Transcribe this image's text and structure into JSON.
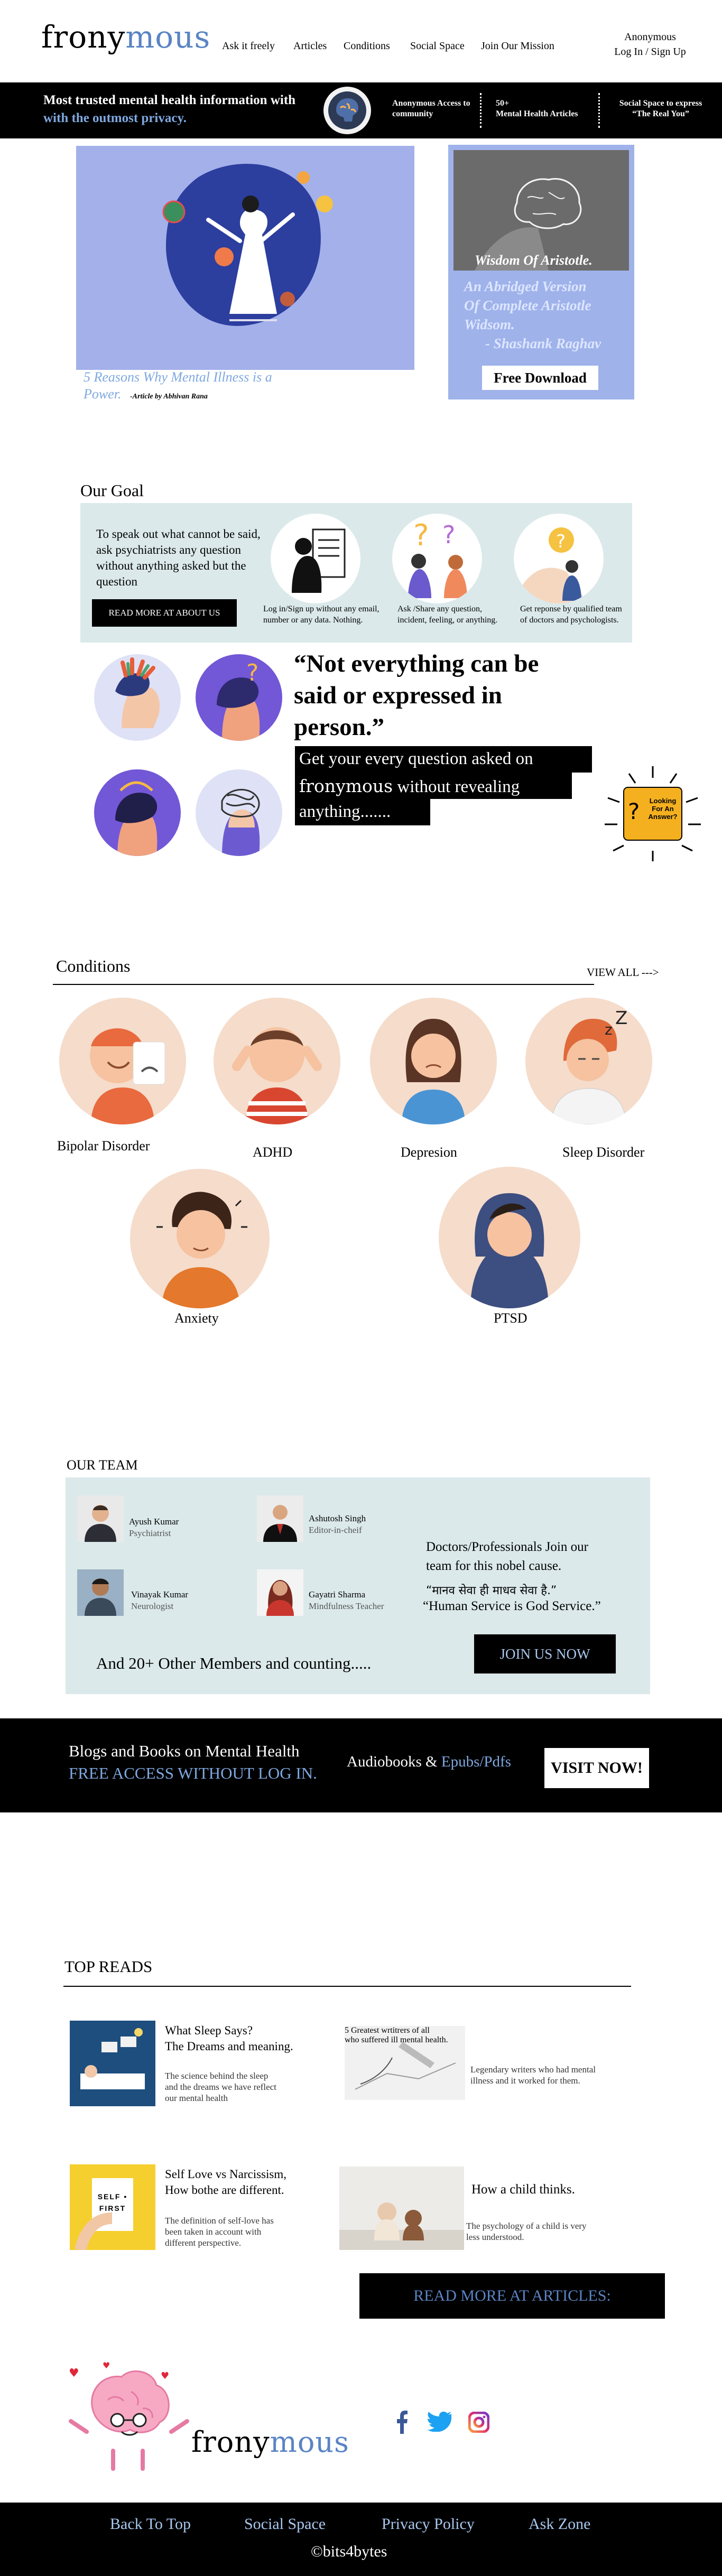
{
  "header": {
    "logo_part1": "frony",
    "logo_part2": "mous",
    "nav": [
      "Ask it freely",
      "Articles",
      "Conditions",
      "Social Space",
      "Join Our Mission"
    ],
    "account_line1": "Anonymous",
    "account_line2": "Log In / Sign Up"
  },
  "banner": {
    "headline": "Most trusted mental health information with",
    "subline": "with the outmost privacy.",
    "feature1": "Anonymous Access to community",
    "feature2_line1": "50+",
    "feature2_line2": "Mental Health Articles",
    "feature3_line1": "Social Space to express",
    "feature3_line2": "“The Real You”"
  },
  "hero": {
    "article_title_line1": "5 Reasons Why Mental Illness is a",
    "article_title_line2": "Power.",
    "article_author": "-Article by Abhivan Rana",
    "book_caption": "Wisdom Of Aristotle.",
    "book_text_line1": "An Abridged Version",
    "book_text_line2": "Of Complete Aristotle",
    "book_text_line3": "Widsom.",
    "book_author": "- Shashank Raghav",
    "download_label": "Free Download"
  },
  "goal": {
    "heading": "Our Goal",
    "statement": "To speak out what cannot be said, ask psychiatrists any question without anything asked but the question",
    "about_button": "READ MORE AT ABOUT US",
    "step1": "Log in/Sign up without any email, number or any data. Nothing.",
    "step2": "Ask /Share any question, incident, feeling, or anything.",
    "step3": "Get reponse by qualified team of doctors and psychologists."
  },
  "quote": {
    "text_line1": "“Not everything can be",
    "text_line2": "said or expressed in",
    "text_line3": "person.”",
    "cta_line1": "Get your every question asked on",
    "cta_brand": "frony",
    "cta_brand2": "mous",
    "cta_line2": " without revealing",
    "cta_line3": "anything.......",
    "badge": "Looking For An Answer?"
  },
  "conditions": {
    "heading": "Conditions",
    "view_all": "VIEW ALL --->",
    "items": [
      "Bipolar Disorder",
      "ADHD",
      "Depresion",
      "Sleep Disorder",
      "Anxiety",
      "PTSD"
    ]
  },
  "team": {
    "heading": "OUR TEAM",
    "members": [
      {
        "name": "Ayush Kumar",
        "role": "Psychiatrist"
      },
      {
        "name": "Ashutosh Singh",
        "role": "Editor-in-cheif"
      },
      {
        "name": "Vinayak Kumar",
        "role": "Neurologist"
      },
      {
        "name": "Gayatri Sharma",
        "role": "Mindfulness Teacher"
      }
    ],
    "join_text_line1": "Doctors/Professionals Join our",
    "join_text_line2": "team for this nobel cause.",
    "hindi_quote": "“मानव सेवा ही माधव सेवा है.”",
    "english_quote": "“Human Service is God Service.”",
    "others": "And 20+ Other Members and counting.....",
    "join_button": "JOIN US NOW"
  },
  "blogs_banner": {
    "title": "Blogs and Books on Mental Health",
    "subtitle": "FREE ACCESS WITHOUT  LOG IN.",
    "audiobooks": "Audiobooks",
    "amp": " & ",
    "epubs": "Epubs/Pdfs",
    "visit_button": "VISIT NOW!"
  },
  "top_reads": {
    "heading": "TOP READS",
    "items": [
      {
        "title_line1": "What Sleep Says?",
        "title_line2": "The Dreams and meaning.",
        "desc": "The science behind the sleep and the dreams we have reflect our mental health"
      },
      {
        "title_line1": "5 Greatest wrtitrers of all",
        "title_line2": "who suffered ill mental health.",
        "desc": "Legendary writers who had mental illness  and it worked for them."
      },
      {
        "title_line1": "Self Love vs Narcissism,",
        "title_line2": "How bothe are different.",
        "desc": "The definition of self-love has been taken in account with different perspective."
      },
      {
        "title_line1": "How a child thinks.",
        "title_line2": "",
        "desc": "The psychology of a child is very less understood."
      }
    ],
    "sign_text": "SELF • FIRST",
    "read_more_button": "READ MORE AT ARTICLES:"
  },
  "footer": {
    "links": [
      "Back To Top",
      "Social Space",
      "Privacy Policy",
      "Ask Zone"
    ],
    "copyright": "©bits4bytes",
    "social": [
      "facebook-icon",
      "twitter-icon",
      "instagram-icon"
    ]
  }
}
